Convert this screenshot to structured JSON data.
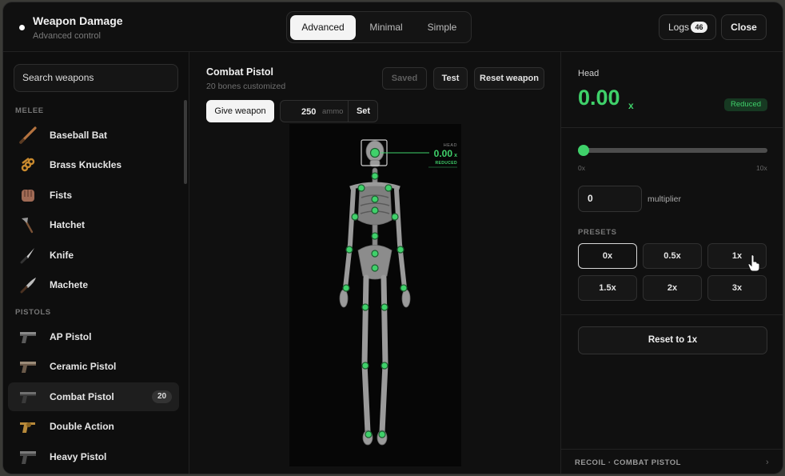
{
  "header": {
    "title": "Weapon Damage",
    "subtitle": "Advanced control",
    "modes": [
      "Advanced",
      "Minimal",
      "Simple"
    ],
    "active_mode": "Advanced",
    "logs_label": "Logs",
    "logs_count": "46",
    "close_label": "Close"
  },
  "sidebar": {
    "search_placeholder": "Search weapons",
    "sections": [
      {
        "label": "MELEE",
        "items": [
          {
            "label": "Baseball Bat",
            "icon": "baseball-bat-icon"
          },
          {
            "label": "Brass Knuckles",
            "icon": "brass-knuckles-icon"
          },
          {
            "label": "Fists",
            "icon": "fists-icon"
          },
          {
            "label": "Hatchet",
            "icon": "hatchet-icon"
          },
          {
            "label": "Knife",
            "icon": "knife-icon"
          },
          {
            "label": "Machete",
            "icon": "machete-icon"
          }
        ]
      },
      {
        "label": "PISTOLS",
        "items": [
          {
            "label": "AP Pistol",
            "icon": "pistol-icon"
          },
          {
            "label": "Ceramic Pistol",
            "icon": "pistol-icon"
          },
          {
            "label": "Combat Pistol",
            "icon": "pistol-icon",
            "count": "20",
            "selected": true
          },
          {
            "label": "Double Action",
            "icon": "revolver-icon"
          },
          {
            "label": "Heavy Pistol",
            "icon": "pistol-icon"
          }
        ]
      }
    ]
  },
  "weapon": {
    "name": "Combat Pistol",
    "subtitle": "20 bones customized",
    "saved_label": "Saved",
    "test_label": "Test",
    "reset_label": "Reset weapon",
    "give_label": "Give weapon",
    "ammo_value": "250",
    "ammo_unit": "ammo",
    "set_label": "Set"
  },
  "viewer": {
    "callout_bone": "HEAD",
    "callout_value": "0.00",
    "callout_unit": "x",
    "callout_status": "REDUCED"
  },
  "panel": {
    "bone": "Head",
    "value": "0.00",
    "unit": "x",
    "status": "Reduced",
    "slider_min": "0x",
    "slider_max": "10x",
    "slider_fraction": 0,
    "multiplier_value": "0",
    "multiplier_label": "multiplier",
    "presets_label": "PRESETS",
    "presets": [
      "0x",
      "0.5x",
      "1x",
      "1.5x",
      "2x",
      "3x"
    ],
    "active_preset": "0x",
    "reset_label": "Reset to 1x",
    "footer_label": "RECOIL · COMBAT PISTOL",
    "footer_chevron": "›"
  },
  "colors": {
    "accent_green": "#3fd16a",
    "background": "#101010",
    "selected_row": "#1e1e1e"
  }
}
